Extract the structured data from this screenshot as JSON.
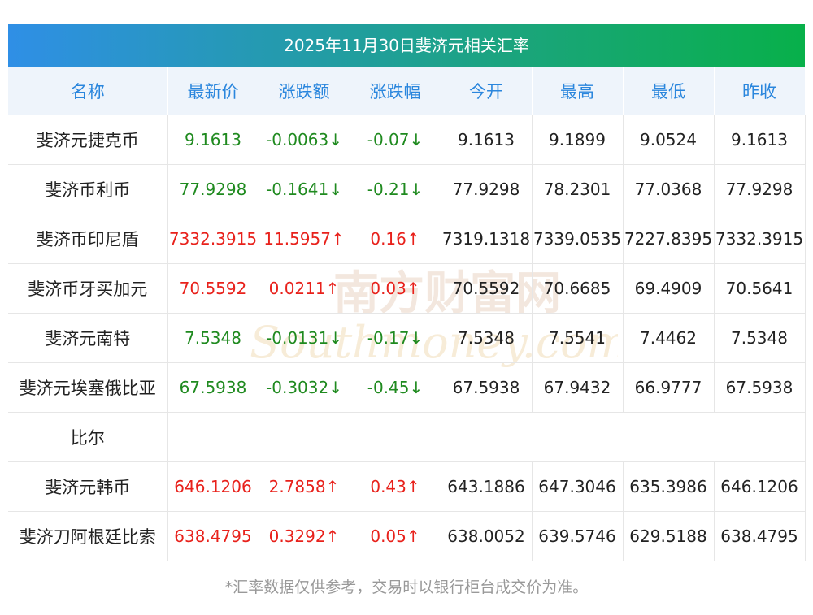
{
  "title": "2025年11月30日斐济元相关汇率",
  "headers": [
    "名称",
    "最新价",
    "涨跌额",
    "涨跌幅",
    "今开",
    "最高",
    "最低",
    "昨收"
  ],
  "rows": [
    {
      "name": "斐济元捷克币",
      "latest": "9.1613",
      "change": "-0.0063↓",
      "pct": "-0.07↓",
      "open": "9.1613",
      "high": "9.1899",
      "low": "9.0524",
      "prev": "9.1613",
      "trend": "down"
    },
    {
      "name": "斐济币利币",
      "latest": "77.9298",
      "change": "-0.1641↓",
      "pct": "-0.21↓",
      "open": "77.9298",
      "high": "78.2301",
      "low": "77.0368",
      "prev": "77.9298",
      "trend": "down"
    },
    {
      "name": "斐济币印尼盾",
      "latest": "7332.3915",
      "change": "11.5957↑",
      "pct": "0.16↑",
      "open": "7319.1318",
      "high": "7339.0535",
      "low": "7227.8395",
      "prev": "7332.3915",
      "trend": "up"
    },
    {
      "name": "斐济币牙买加元",
      "latest": "70.5592",
      "change": "0.0211↑",
      "pct": "0.03↑",
      "open": "70.5592",
      "high": "70.6685",
      "low": "69.4909",
      "prev": "70.5641",
      "trend": "up"
    },
    {
      "name": "斐济元南特",
      "latest": "7.5348",
      "change": "-0.0131↓",
      "pct": "-0.17↓",
      "open": "7.5348",
      "high": "7.5541",
      "low": "7.4462",
      "prev": "7.5348",
      "trend": "down"
    },
    {
      "name": "斐济元埃塞俄比亚",
      "latest": "67.5938",
      "change": "-0.3032↓",
      "pct": "-0.45↓",
      "open": "67.5938",
      "high": "67.9432",
      "low": "66.9777",
      "prev": "67.5938",
      "trend": "down"
    },
    {
      "name": "比尔"
    },
    {
      "name": "斐济元韩币",
      "latest": "646.1206",
      "change": "2.7858↑",
      "pct": "0.43↑",
      "open": "643.1886",
      "high": "647.3046",
      "low": "635.3986",
      "prev": "646.1206",
      "trend": "up"
    },
    {
      "name": "斐济刀阿根廷比索",
      "latest": "638.4795",
      "change": "0.3292↑",
      "pct": "0.05↑",
      "open": "638.0052",
      "high": "639.5746",
      "low": "629.5188",
      "prev": "638.4795",
      "trend": "up"
    }
  ],
  "watermark": {
    "cn": "南方财富网",
    "en": "Southmoney.com"
  },
  "footnote": "*汇率数据仅供参考，交易时以银行柜台成交价为准。",
  "colors": {
    "up": "#e8211b",
    "down": "#1f8a1f",
    "header_text": "#2a86dd",
    "header_bg": "#eef4fb",
    "title_start": "#2f8fe6",
    "title_end": "#08b04a"
  }
}
